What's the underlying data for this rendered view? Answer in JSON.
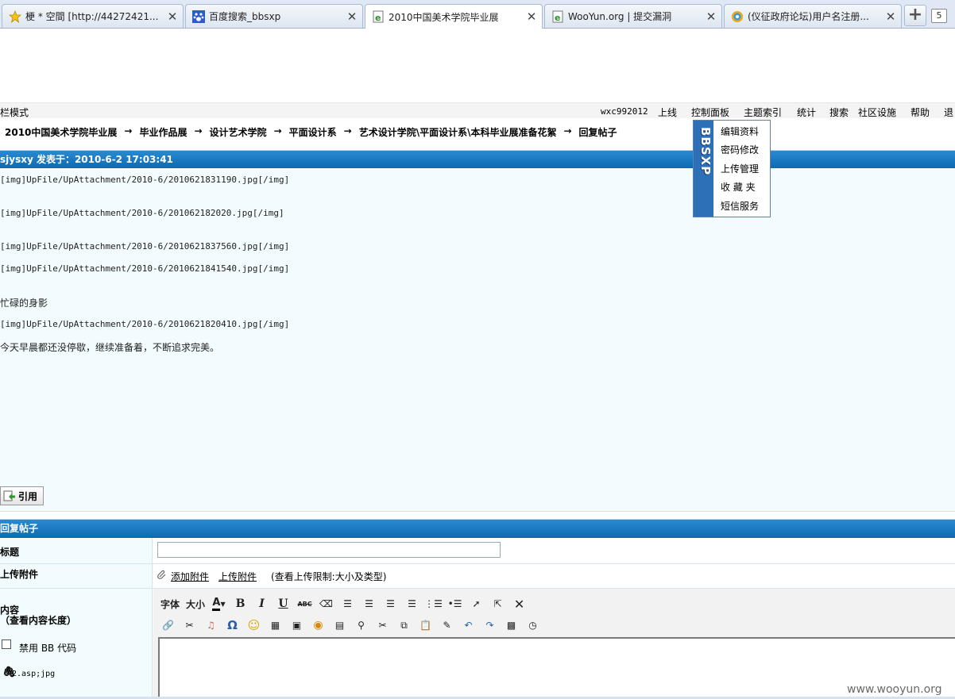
{
  "tabs": [
    {
      "title": "梗 * 空間 [http://44272421...",
      "icon": "star-icon",
      "active": false
    },
    {
      "title": "百度搜索_bbsxp",
      "icon": "paw-icon",
      "active": false
    },
    {
      "title": "2010中国美术学院毕业展",
      "icon": "ie-page-icon",
      "active": true
    },
    {
      "title": "WooYun.org | 提交漏洞",
      "icon": "ie-page-icon",
      "active": false
    },
    {
      "title": "(仪征政府论坛)用户名注册...",
      "icon": "globe-icon",
      "active": false
    }
  ],
  "tabbar": {
    "new_tab": "+",
    "tab_count": "5"
  },
  "nav": {
    "mode": "栏模式",
    "username": "wxc992012",
    "items": [
      "上线",
      "控制面板",
      "主题索引",
      "统计",
      "搜索",
      "社区设施",
      "帮助",
      "退"
    ]
  },
  "breadcrumb": [
    "2010中国美术学院毕业展",
    "毕业作品展",
    "设计艺术学院",
    "平面设计系",
    "艺术设计学院\\平面设计系\\本科毕业展准备花絮",
    "回复帖子"
  ],
  "breadcrumb_sep": "→",
  "dropdown": {
    "logo": "BBSXP",
    "items": [
      "编辑资料",
      "密码修改",
      "上传管理",
      "收 藏 夹",
      "短信服务"
    ]
  },
  "post": {
    "header": "sjysxy 发表于：2010-6-2 17:03:41",
    "lines": [
      "[img]UpFile/UpAttachment/2010-6/2010621831190.jpg[/img]",
      "[img]UpFile/UpAttachment/2010-6/201062182020.jpg[/img]",
      "[img]UpFile/UpAttachment/2010-6/2010621837560.jpg[/img]",
      "[img]UpFile/UpAttachment/2010-6/2010621841540.jpg[/img]",
      "忙碌的身影",
      "[img]UpFile/UpAttachment/2010-6/2010621820410.jpg[/img]",
      "今天早晨都还没停歇，继续准备着，不断追求完美。"
    ],
    "quote_button": "引用"
  },
  "reply": {
    "header": "回复帖子",
    "title_label": "标题",
    "title_value": "",
    "upload_label": "上传附件",
    "add_attachment": "添加附件",
    "upload_attachment": "上传附件",
    "upload_hint": "(查看上传限制:大小及类型)",
    "content_label": "内容",
    "content_length": "（查看内容长度）",
    "disable_bb": "禁用 BB 代码",
    "attachment_file": "2.asp;jpg",
    "toolbar_font": "字体",
    "toolbar_size": "大小"
  },
  "watermark": "www.wooyun.org"
}
